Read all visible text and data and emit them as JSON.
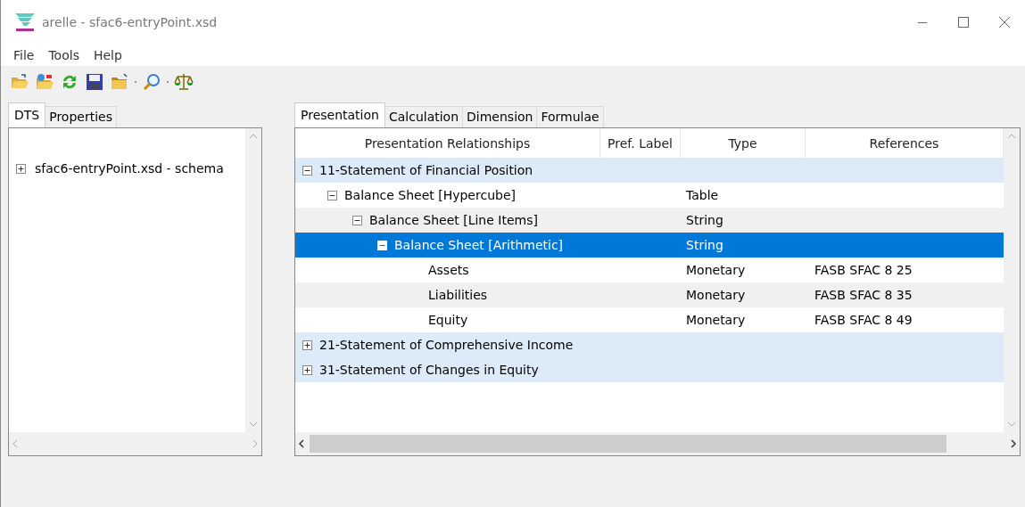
{
  "window": {
    "title": "arelle - sfac6-entryPoint.xsd"
  },
  "menu": [
    "File",
    "Tools",
    "Help"
  ],
  "left_tabs": [
    {
      "label": "DTS",
      "selected": true
    },
    {
      "label": "Properties",
      "selected": false
    }
  ],
  "dts_tree": [
    {
      "label": "sfac6-entryPoint.xsd - schema",
      "expanded": false
    }
  ],
  "right_tabs": [
    {
      "label": "Presentation",
      "selected": true
    },
    {
      "label": "Calculation",
      "selected": false
    },
    {
      "label": "Dimension",
      "selected": false
    },
    {
      "label": "Formulae",
      "selected": false
    }
  ],
  "table": {
    "columns": [
      "Presentation Relationships",
      "Pref. Label",
      "Type",
      "References"
    ],
    "rows": [
      {
        "label": "11-Statement of Financial Position",
        "expanded": true,
        "selected": false,
        "children": [
          {
            "label": "Balance Sheet [Hypercube]",
            "type": "Table",
            "expanded": true,
            "selected": false,
            "children": [
              {
                "label": "Balance Sheet [Line Items]",
                "type": "String",
                "expanded": true,
                "selected": false,
                "children": [
                  {
                    "label": "Balance Sheet [Arithmetic]",
                    "type": "String",
                    "expanded": true,
                    "selected": true,
                    "children": [
                      {
                        "label": "Assets",
                        "type": "Monetary",
                        "references": "FASB SFAC 8 25",
                        "selected": false
                      },
                      {
                        "label": "Liabilities",
                        "type": "Monetary",
                        "references": "FASB SFAC 8 35",
                        "selected": false
                      },
                      {
                        "label": "Equity",
                        "type": "Monetary",
                        "references": "FASB SFAC 8 49",
                        "selected": false
                      }
                    ]
                  }
                ]
              }
            ]
          }
        ]
      },
      {
        "label": "21-Statement of Comprehensive Income",
        "expanded": false,
        "selected": false
      },
      {
        "label": "31-Statement of Changes in Equity",
        "expanded": false,
        "selected": false
      }
    ]
  }
}
